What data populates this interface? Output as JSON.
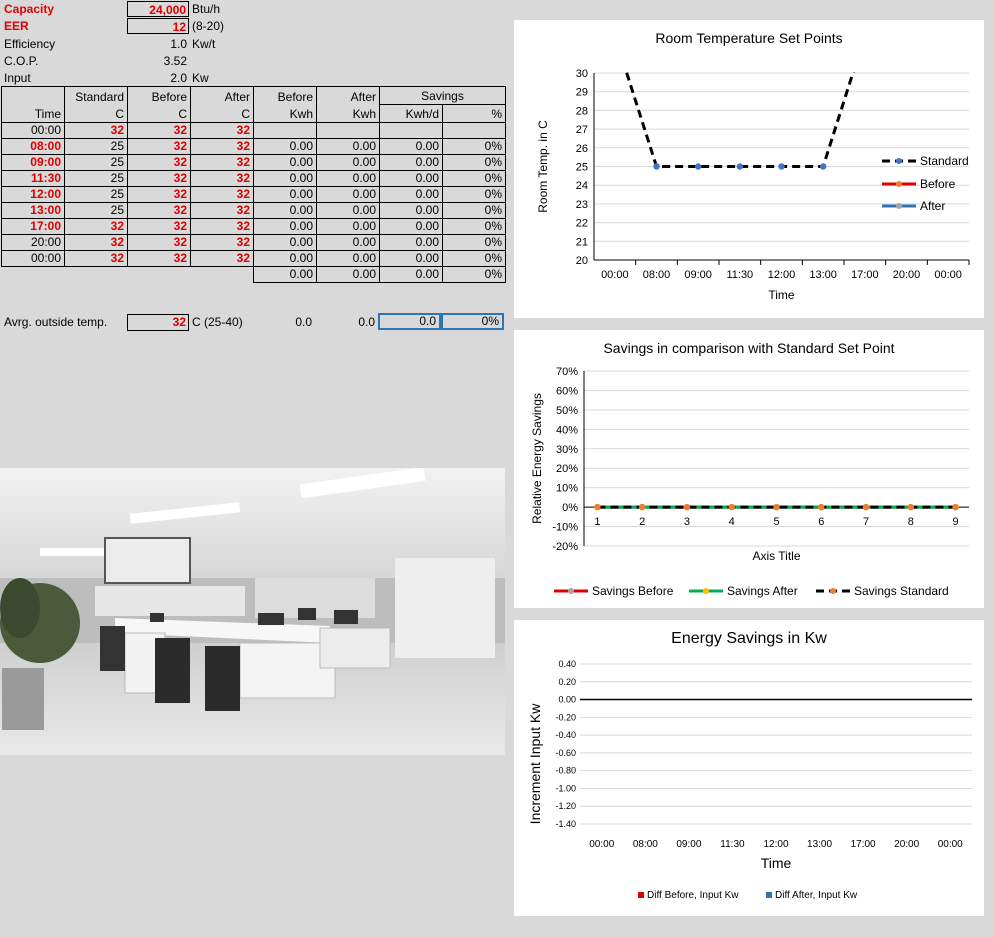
{
  "params": {
    "capacity": {
      "label": "Capacity",
      "value": "24,000",
      "unit": "Btu/h"
    },
    "eer": {
      "label": "EER",
      "value": "12",
      "unit": "(8-20)"
    },
    "efficiency": {
      "label": "Efficiency",
      "value": "1.0",
      "unit": "Kw/t"
    },
    "cop": {
      "label": "C.O.P.",
      "value": "3.52"
    },
    "input": {
      "label": "Input",
      "value": "2.0",
      "unit": "Kw"
    }
  },
  "table": {
    "headers_top": [
      "",
      "Standard",
      "Before",
      "After",
      "Before",
      "After",
      "Savings"
    ],
    "headers_bottom": [
      "Time",
      "C",
      "C",
      "C",
      "Kwh",
      "Kwh",
      "Kwh/d",
      "%"
    ],
    "rows": [
      {
        "time": "00:00",
        "time_red": false,
        "std": "32",
        "std_red": true,
        "before": "32",
        "after": "32",
        "bkwh": "",
        "akwh": "",
        "skwh": "",
        "pct": ""
      },
      {
        "time": "08:00",
        "time_red": true,
        "std": "25",
        "std_red": false,
        "before": "32",
        "after": "32",
        "bkwh": "0.00",
        "akwh": "0.00",
        "skwh": "0.00",
        "pct": "0%"
      },
      {
        "time": "09:00",
        "time_red": true,
        "std": "25",
        "std_red": false,
        "before": "32",
        "after": "32",
        "bkwh": "0.00",
        "akwh": "0.00",
        "skwh": "0.00",
        "pct": "0%"
      },
      {
        "time": "11:30",
        "time_red": true,
        "std": "25",
        "std_red": false,
        "before": "32",
        "after": "32",
        "bkwh": "0.00",
        "akwh": "0.00",
        "skwh": "0.00",
        "pct": "0%"
      },
      {
        "time": "12:00",
        "time_red": true,
        "std": "25",
        "std_red": false,
        "before": "32",
        "after": "32",
        "bkwh": "0.00",
        "akwh": "0.00",
        "skwh": "0.00",
        "pct": "0%"
      },
      {
        "time": "13:00",
        "time_red": true,
        "std": "25",
        "std_red": false,
        "before": "32",
        "after": "32",
        "bkwh": "0.00",
        "akwh": "0.00",
        "skwh": "0.00",
        "pct": "0%"
      },
      {
        "time": "17:00",
        "time_red": true,
        "std": "32",
        "std_red": true,
        "before": "32",
        "after": "32",
        "bkwh": "0.00",
        "akwh": "0.00",
        "skwh": "0.00",
        "pct": "0%"
      },
      {
        "time": "20:00",
        "time_red": false,
        "std": "32",
        "std_red": true,
        "before": "32",
        "after": "32",
        "bkwh": "0.00",
        "akwh": "0.00",
        "skwh": "0.00",
        "pct": "0%"
      },
      {
        "time": "00:00",
        "time_red": false,
        "std": "32",
        "std_red": true,
        "before": "32",
        "after": "32",
        "bkwh": "0.00",
        "akwh": "0.00",
        "skwh": "0.00",
        "pct": "0%"
      }
    ],
    "totals": {
      "bkwh": "0.00",
      "akwh": "0.00",
      "skwh": "0.00",
      "pct": "0%"
    }
  },
  "avg": {
    "label": "Avrg. outside temp.",
    "value": "32",
    "unit": "C (25-40)",
    "v1": "0.0",
    "v2": "0.0",
    "v3": "0.0",
    "pct": "0%"
  },
  "charts": {
    "temp": {
      "title": "Room Temperature Set Points",
      "ylabel": "Room Temp. in C",
      "xlabel": "Time",
      "categories": [
        "00:00",
        "08:00",
        "09:00",
        "11:30",
        "12:00",
        "13:00",
        "17:00",
        "20:00",
        "00:00"
      ],
      "yticks": [
        "30",
        "29",
        "28",
        "27",
        "26",
        "25",
        "24",
        "23",
        "22",
        "21",
        "20"
      ],
      "legend": [
        "Standard",
        "Before",
        "After"
      ]
    },
    "savings": {
      "title": "Savings in comparison with Standard Set Point",
      "ylabel": "Relative Energy Savings",
      "xlabel": "Axis Title",
      "categories": [
        "1",
        "2",
        "3",
        "4",
        "5",
        "6",
        "7",
        "8",
        "9"
      ],
      "yticks": [
        "70%",
        "60%",
        "50%",
        "40%",
        "30%",
        "20%",
        "10%",
        "0%",
        "-10%",
        "-20%"
      ],
      "legend": [
        "Savings Before",
        "Savings After",
        "Savings Standard"
      ]
    },
    "energy": {
      "title": "Energy Savings in Kw",
      "ylabel": "Increment Input Kw",
      "xlabel": "Time",
      "categories": [
        "00:00",
        "08:00",
        "09:00",
        "11:30",
        "12:00",
        "13:00",
        "17:00",
        "20:00",
        "00:00"
      ],
      "yticks": [
        "0.40",
        "0.20",
        "0.00",
        "-0.20",
        "-0.40",
        "-0.60",
        "-0.80",
        "-1.00",
        "-1.20",
        "-1.40"
      ],
      "legend": [
        "Diff Before, Input Kw",
        "Diff After, Input Kw"
      ]
    }
  },
  "chart_data": [
    {
      "type": "line",
      "title": "Room Temperature Set Points",
      "xlabel": "Time",
      "ylabel": "Room Temp. in C",
      "categories": [
        "00:00",
        "08:00",
        "09:00",
        "11:30",
        "12:00",
        "13:00",
        "17:00",
        "20:00",
        "00:00"
      ],
      "ylim": [
        20,
        30
      ],
      "series": [
        {
          "name": "Standard",
          "values": [
            32,
            25,
            25,
            25,
            25,
            25,
            32,
            32,
            32
          ]
        },
        {
          "name": "Before",
          "values": [
            32,
            32,
            32,
            32,
            32,
            32,
            32,
            32,
            32
          ]
        },
        {
          "name": "After",
          "values": [
            32,
            32,
            32,
            32,
            32,
            32,
            32,
            32,
            32
          ]
        }
      ],
      "colors": {
        "Standard": "#000000",
        "Before": "#e00000",
        "After": "#2e75b6"
      }
    },
    {
      "type": "line",
      "title": "Savings in comparison with Standard Set Point",
      "xlabel": "Axis Title",
      "ylabel": "Relative Energy Savings",
      "categories": [
        "1",
        "2",
        "3",
        "4",
        "5",
        "6",
        "7",
        "8",
        "9"
      ],
      "ylim": [
        -0.2,
        0.7
      ],
      "series": [
        {
          "name": "Savings Before",
          "values": [
            0,
            0,
            0,
            0,
            0,
            0,
            0,
            0,
            0
          ]
        },
        {
          "name": "Savings After",
          "values": [
            0,
            0,
            0,
            0,
            0,
            0,
            0,
            0,
            0
          ]
        },
        {
          "name": "Savings Standard",
          "values": [
            0,
            0,
            0,
            0,
            0,
            0,
            0,
            0,
            0
          ]
        }
      ],
      "colors": {
        "Savings Before": "#e00000",
        "Savings After": "#00b050",
        "Savings Standard": "#000000"
      }
    },
    {
      "type": "bar",
      "title": "Energy Savings in Kw",
      "xlabel": "Time",
      "ylabel": "Increment Input Kw",
      "categories": [
        "00:00",
        "08:00",
        "09:00",
        "11:30",
        "12:00",
        "13:00",
        "17:00",
        "20:00",
        "00:00"
      ],
      "ylim": [
        -1.4,
        0.4
      ],
      "series": [
        {
          "name": "Diff Before, Input Kw",
          "values": [
            0,
            0,
            0,
            0,
            0,
            0,
            0,
            0,
            0
          ]
        },
        {
          "name": "Diff After, Input Kw",
          "values": [
            0,
            0,
            0,
            0,
            0,
            0,
            0,
            0,
            0
          ]
        }
      ],
      "colors": {
        "Diff Before, Input Kw": "#e00000",
        "Diff After, Input Kw": "#2e75b6"
      }
    }
  ]
}
